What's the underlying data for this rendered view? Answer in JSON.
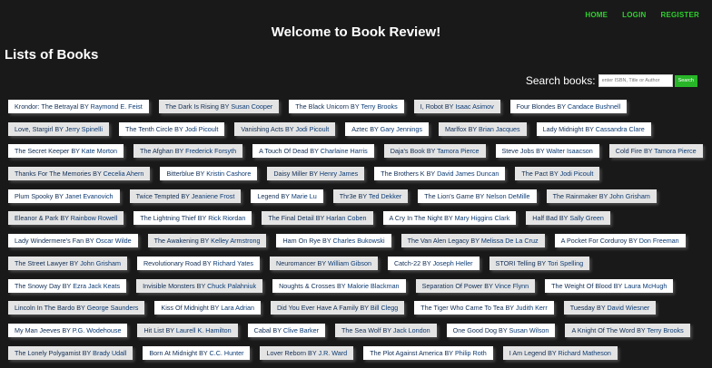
{
  "nav": {
    "home": "HOME",
    "login": "LOGIN",
    "register": "REGISTER"
  },
  "header": {
    "welcome": "Welcome to Book Review!"
  },
  "main": {
    "title": "Lists of Books"
  },
  "search": {
    "label": "Search books:",
    "placeholder": "enter ISBN, Title or Author",
    "button": "Search"
  },
  "colors": {
    "background": "#191919",
    "nav_link": "#2ed12e",
    "search_button": "#28b628",
    "link_text": "#0f2d55"
  },
  "book_rows": [
    [
      {
        "title": "Krondor: The Betrayal",
        "author": "Raymond E. Feist"
      },
      {
        "title": "The Dark Is Rising",
        "author": "Susan Cooper"
      },
      {
        "title": "The Black Unicorn",
        "author": "Terry Brooks"
      },
      {
        "title": "I, Robot",
        "author": "Isaac Asimov"
      },
      {
        "title": "Four Blondes",
        "author": "Candace Bushnell"
      }
    ],
    [
      {
        "title": "Love, Stargirl",
        "author": "Jerry Spinelli"
      },
      {
        "title": "The Tenth Circle",
        "author": "Jodi Picoult"
      },
      {
        "title": "Vanishing Acts",
        "author": "Jodi Picoult"
      },
      {
        "title": "Aztec",
        "author": "Gary Jennings"
      },
      {
        "title": "Marlfox",
        "author": "Brian Jacques"
      },
      {
        "title": "Lady Midnight",
        "author": "Cassandra Clare"
      }
    ],
    [
      {
        "title": "The Secret Keeper",
        "author": "Kate Morton"
      },
      {
        "title": "The Afghan",
        "author": "Frederick Forsyth"
      },
      {
        "title": "A Touch Of Dead",
        "author": "Charlaine Harris"
      },
      {
        "title": "Daja's Book",
        "author": "Tamora Pierce"
      },
      {
        "title": "Steve Jobs",
        "author": "Walter Isaacson"
      },
      {
        "title": "Cold Fire",
        "author": "Tamora Pierce"
      }
    ],
    [
      {
        "title": "Thanks For The Memories",
        "author": "Cecelia Ahern"
      },
      {
        "title": "Bitterblue",
        "author": "Kristin Cashore"
      },
      {
        "title": "Daisy Miller",
        "author": "Henry James"
      },
      {
        "title": "The Brothers K",
        "author": "David James Duncan"
      },
      {
        "title": "The Pact",
        "author": "Jodi Picoult"
      }
    ],
    [
      {
        "title": "Plum Spooky",
        "author": "Janet Evanovich"
      },
      {
        "title": "Twice Tempted",
        "author": "Jeaniene Frost"
      },
      {
        "title": "Legend",
        "author": "Marie Lu"
      },
      {
        "title": "Thr3e",
        "author": "Ted Dekker"
      },
      {
        "title": "The Lion's Game",
        "author": "Nelson DeMille"
      },
      {
        "title": "The Rainmaker",
        "author": "John Grisham"
      }
    ],
    [
      {
        "title": "Eleanor & Park",
        "author": "Rainbow Rowell"
      },
      {
        "title": "The Lightning Thief",
        "author": "Rick Riordan"
      },
      {
        "title": "The Final Detail",
        "author": "Harlan Coben"
      },
      {
        "title": "A Cry In The Night",
        "author": "Mary Higgins Clark"
      },
      {
        "title": "Half Bad",
        "author": "Sally Green"
      }
    ],
    [
      {
        "title": "Lady Windermere's Fan",
        "author": "Oscar Wilde"
      },
      {
        "title": "The Awakening",
        "author": "Kelley Armstrong"
      },
      {
        "title": "Ham On Rye",
        "author": "Charles Bukowski"
      },
      {
        "title": "The Van Alen Legacy",
        "author": "Melissa De La Cruz"
      },
      {
        "title": "A Pocket For Corduroy",
        "author": "Don Freeman"
      }
    ],
    [
      {
        "title": "The Street Lawyer",
        "author": "John Grisham"
      },
      {
        "title": "Revolutionary Road",
        "author": "Richard Yates"
      },
      {
        "title": "Neuromancer",
        "author": "William Gibson"
      },
      {
        "title": "Catch-22",
        "author": "Joseph Heller"
      },
      {
        "title": "STORI Telling",
        "author": "Tori Spelling"
      }
    ],
    [
      {
        "title": "The Snowy Day",
        "author": "Ezra Jack Keats"
      },
      {
        "title": "Invisible Monsters",
        "author": "Chuck Palahniuk"
      },
      {
        "title": "Noughts & Crosses",
        "author": "Malorie Blackman"
      },
      {
        "title": "Separation Of Power",
        "author": "Vince Flynn"
      },
      {
        "title": "The Weight Of Blood",
        "author": "Laura McHugh"
      }
    ],
    [
      {
        "title": "Lincoln In The Bardo",
        "author": "George Saunders"
      },
      {
        "title": "Kiss Of Midnight",
        "author": "Lara Adrian"
      },
      {
        "title": "Did You Ever Have A Family",
        "author": "Bill Clegg"
      },
      {
        "title": "The Tiger Who Came To Tea",
        "author": "Judith Kerr"
      },
      {
        "title": "Tuesday",
        "author": "David Wiesner"
      }
    ],
    [
      {
        "title": "My Man Jeeves",
        "author": "P.G. Wodehouse"
      },
      {
        "title": "Hit List",
        "author": "Laurell K. Hamilton"
      },
      {
        "title": "Cabal",
        "author": "Clive Barker"
      },
      {
        "title": "The Sea Wolf",
        "author": "Jack London"
      },
      {
        "title": "One Good Dog",
        "author": "Susan Wilson"
      },
      {
        "title": "A Knight Of The Word",
        "author": "Terry Brooks"
      }
    ],
    [
      {
        "title": "The Lonely Polygamist",
        "author": "Brady Udall"
      },
      {
        "title": "Born At Midnight",
        "author": "C.C. Hunter"
      },
      {
        "title": "Lover Reborn",
        "author": "J.R. Ward"
      },
      {
        "title": "The Plot Against America",
        "author": "Philip Roth"
      },
      {
        "title": "I Am Legend",
        "author": "Richard Matheson"
      }
    ]
  ]
}
